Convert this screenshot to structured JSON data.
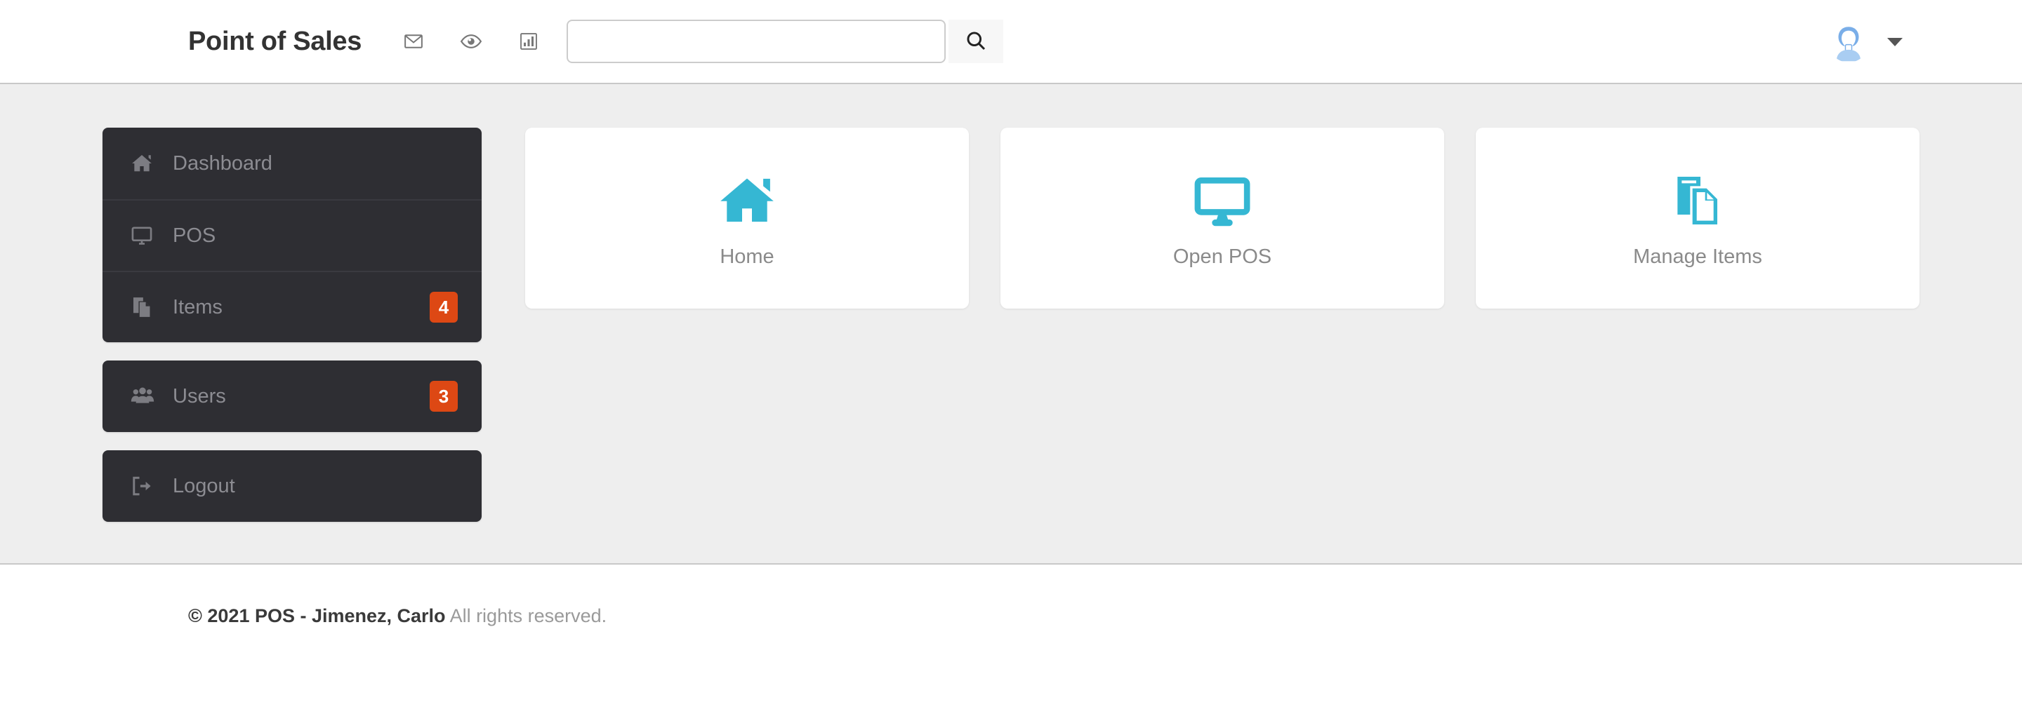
{
  "header": {
    "brand": "Point of Sales",
    "icons": [
      {
        "name": "mail-icon",
        "label": "Messages"
      },
      {
        "name": "eye-icon",
        "label": "Views"
      },
      {
        "name": "chart-bar-icon",
        "label": "Statistics"
      }
    ],
    "search": {
      "value": "",
      "placeholder": "",
      "button_icon": "search-icon"
    },
    "user": {
      "avatar_icon": "user-avatar-icon",
      "caret_icon": "caret-down-icon"
    }
  },
  "sidebar": {
    "group": [
      {
        "label": "Dashboard",
        "icon": "home-icon",
        "badge": null
      },
      {
        "label": "POS",
        "icon": "desktop-icon",
        "badge": null
      },
      {
        "label": "Items",
        "icon": "copy-files-icon",
        "badge": "4"
      }
    ],
    "users": {
      "label": "Users",
      "icon": "users-icon",
      "badge": "3"
    },
    "logout": {
      "label": "Logout",
      "icon": "sign-out-icon",
      "badge": null
    }
  },
  "main": {
    "tiles": [
      {
        "label": "Home",
        "icon": "home-icon"
      },
      {
        "label": "Open POS",
        "icon": "desktop-icon"
      },
      {
        "label": "Manage Items",
        "icon": "copy-files-icon"
      }
    ]
  },
  "footer": {
    "copyright": "© 2021 POS - Jimenez, Carlo",
    "rights": "All rights reserved."
  },
  "colors": {
    "accent": "#35b7d3",
    "badge": "#dd4814",
    "sidebar_bg": "#2e2e33",
    "page_bg": "#eeeeee"
  }
}
